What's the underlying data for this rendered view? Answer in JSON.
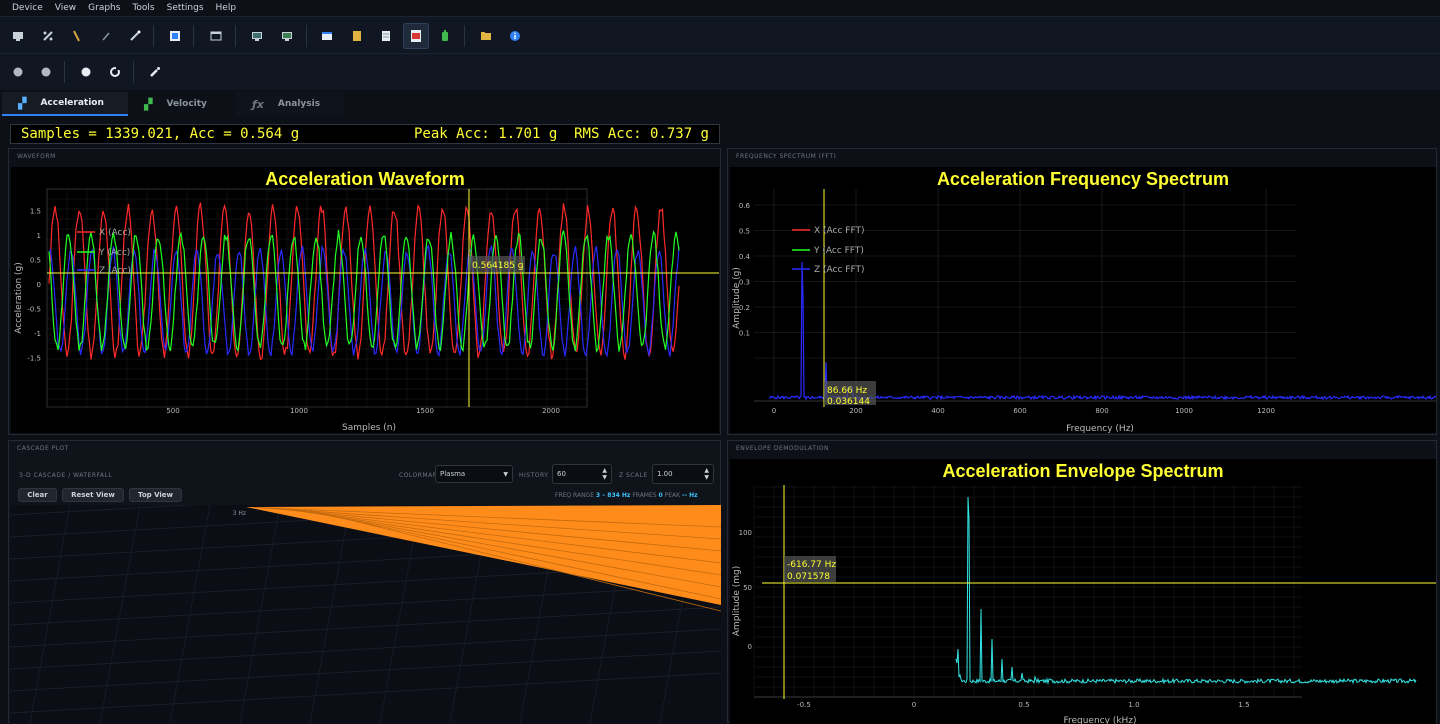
{
  "menu": [
    "Device",
    "View",
    "Graphs",
    "Tools",
    "Settings",
    "Help"
  ],
  "toolbar1_icons": [
    "connect-icon",
    "calibrate-icon",
    "probe-icon",
    "pen-icon",
    "wand-icon",
    "export-icon",
    "window-icon",
    "monitor-left-icon",
    "monitor-right-icon",
    "browser-icon",
    "clipboard-icon",
    "document-icon",
    "pdf-icon",
    "battery-icon",
    "folder-icon",
    "info-icon"
  ],
  "toolbar2_icons": [
    "record-dot-icon",
    "stop-dot-icon",
    "dot-icon",
    "refresh-icon",
    "brush-icon"
  ],
  "tabs": [
    {
      "label": "Acceleration",
      "icon": "chart-icon",
      "active": true
    },
    {
      "label": "Velocity",
      "icon": "chart-icon",
      "active": false
    },
    {
      "label": "Analysis",
      "icon": "function-icon",
      "active": false
    }
  ],
  "status": {
    "left": "Samples = 1339.021, Acc = 0.564 g",
    "right": "Peak Acc: 1.701 g  RMS Acc: 0.737 g"
  },
  "waveform": {
    "panel_title": "WAVEFORM",
    "title": "Acceleration Waveform",
    "xlabel": "Samples (n)",
    "ylabel": "Acceleration (g)",
    "cursor_label": "0.564185 g",
    "legend": [
      "X (Acc)",
      "Y (Acc)",
      "Z (Acc)"
    ],
    "yticks": [
      "1.5",
      "1",
      "0.5",
      "0",
      "-0.5",
      "-1",
      "-1.5"
    ],
    "xticks": [
      "500",
      "1000",
      "1500",
      "2000"
    ]
  },
  "fft": {
    "panel_title": "FREQUENCY SPECTRUM (FFT)",
    "title": "Acceleration Frequency Spectrum",
    "xlabel": "Frequency (Hz)",
    "ylabel": "Amplitude (g)",
    "cursor_label_1": "86.66 Hz",
    "cursor_label_2": "0.036144",
    "legend": [
      "X (Acc FFT)",
      "Y (Acc FFT)",
      "Z (Acc FFT)"
    ],
    "yticks": [
      "0.6",
      "0.5",
      "0.4",
      "0.3",
      "0.2",
      "0.1"
    ],
    "xticks": [
      "0",
      "200",
      "400",
      "600",
      "800",
      "1000",
      "1200"
    ]
  },
  "cascade": {
    "panel_title": "CASCADE PLOT",
    "subtitle": "3-D CASCADE / WATERFALL",
    "colormap_label": "COLORMAP",
    "colormap_value": "Plasma",
    "history_label": "HISTORY",
    "history_value": "60",
    "zscale_label": "Z SCALE",
    "zscale_value": "1.00",
    "buttons": {
      "clear": "Clear",
      "reset": "Reset View",
      "top": "Top View"
    },
    "freq_range_label": "FREQ RANGE",
    "freq_range_value": "3 – 834 Hz",
    "frames_label": "FRAMES",
    "frames_value": "0",
    "peak_label": "PEAK",
    "peak_value": "-- Hz",
    "axis_label": "3 Hz"
  },
  "envelope": {
    "panel_title": "ENVELOPE DEMODULATION",
    "title": "Acceleration Envelope Spectrum",
    "xlabel": "Frequency (kHz)",
    "ylabel": "Amplitude (mg)",
    "cursor_label_1": "-616.77 Hz",
    "cursor_label_2": "0.071578",
    "yticks": [
      "100",
      "50",
      "0"
    ],
    "xticks": [
      "-0.5",
      "0",
      "0.5",
      "1.0",
      "1.5"
    ]
  },
  "colors": {
    "accent_yellow": "#ffff33",
    "x_series": "#ff2a2a",
    "y_series": "#22ff22",
    "z_series": "#2a2aff",
    "envelope": "#33e6e6",
    "cascade_fill": "#ff8c1a"
  }
}
